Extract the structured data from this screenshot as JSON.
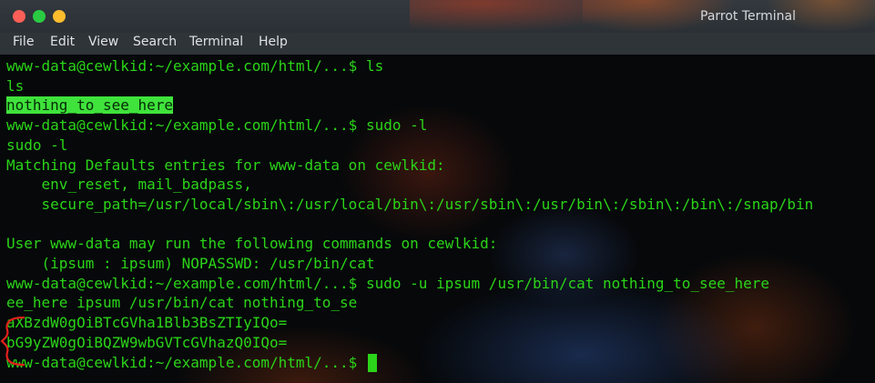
{
  "window": {
    "title": "Parrot Terminal"
  },
  "menu": [
    "File",
    "Edit",
    "View",
    "Search",
    "Terminal",
    "Help"
  ],
  "terminal": {
    "lines": [
      "www-data@cewlkid:~/example.com/html/...$ ls",
      "ls",
      "nothing_to_see_here",
      "www-data@cewlkid:~/example.com/html/...$ sudo -l",
      "sudo -l",
      "Matching Defaults entries for www-data on cewlkid:",
      "    env_reset, mail_badpass,",
      "    secure_path=/usr/local/sbin\\:/usr/local/bin\\:/usr/sbin\\:/usr/bin\\:/sbin\\:/bin\\:/snap/bin",
      "",
      "User www-data may run the following commands on cewlkid:",
      "    (ipsum : ipsum) NOPASSWD: /usr/bin/cat",
      "www-data@cewlkid:~/example.com/html/...$ sudo -u ipsum /usr/bin/cat nothing_to_see_here",
      "ee_here ipsum /usr/bin/cat nothing_to_se",
      "aXBzdW0gOiBTcGVha1Blb3BsZTIyIQo=",
      "bG9yZW0gOiBQZW9wbGVTcGVhazQ0IQo=",
      "www-data@cewlkid:~/example.com/html/...$ "
    ]
  },
  "colors": {
    "terminal_text": "#2bd418",
    "highlight": "#3fe33b",
    "annotation": "#e0201a"
  }
}
